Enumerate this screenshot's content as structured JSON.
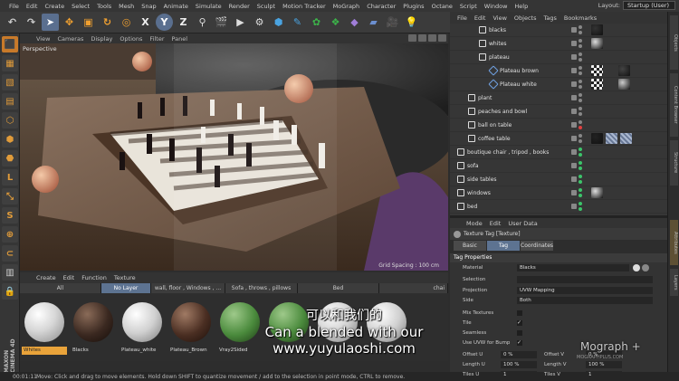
{
  "menubar": {
    "items": [
      "File",
      "Edit",
      "Create",
      "Select",
      "Tools",
      "Mesh",
      "Snap",
      "Animate",
      "Simulate",
      "Render",
      "Sculpt",
      "Motion Tracker",
      "MoGraph",
      "Character",
      "Plugins",
      "Octane",
      "Script",
      "Window",
      "Help"
    ],
    "layout_label": "Layout:",
    "layout_value": "Startup (User)"
  },
  "toolbar": {
    "icons": [
      "arrow-icon",
      "move-icon",
      "scale-icon",
      "rotate-icon",
      "recent-icon",
      "x-axis",
      "y-axis",
      "z-axis",
      "coord-icon",
      "render-region-icon",
      "render-view-icon",
      "render-settings-icon",
      "cube-icon",
      "pen-icon",
      "subdivide-icon",
      "array-icon",
      "deformer-icon",
      "floor-icon",
      "camera-icon",
      "light-icon"
    ],
    "x": "X",
    "y": "Y",
    "z": "Z"
  },
  "viewport": {
    "menu": [
      "View",
      "Cameras",
      "Display",
      "Options",
      "Filter",
      "Panel"
    ],
    "label": "Perspective",
    "grid": "Grid Spacing : 100 cm"
  },
  "materials": {
    "menu": [
      "Create",
      "Edit",
      "Function",
      "Texture"
    ],
    "tabs": [
      "All",
      "No Layer",
      "wall, floor , Windows , ...",
      "Sofa , throws , pillows",
      "Bed",
      "chai"
    ],
    "active_tab": "No Layer",
    "items": [
      "Whites",
      "Blacks",
      "Plateau_white",
      "Plateau_Brown",
      "Vray2Sided",
      ""
    ],
    "active_item": "Whites"
  },
  "subtitle": {
    "cn": "可以和我们的",
    "en1": "Can a blended with our",
    "en2": "www.yuyulaoshi.com"
  },
  "maxon": "MAXON CINEMA 4D",
  "status": {
    "time": "00:01:11",
    "text": "Move: Click and drag to move elements. Hold down SHIFT to quantize movement / add to the selection in point mode, CTRL to remove."
  },
  "objects": {
    "menu": [
      "File",
      "Edit",
      "View",
      "Objects",
      "Tags",
      "Bookmarks"
    ],
    "rows": [
      {
        "name": "blacks",
        "indent": 2
      },
      {
        "name": "whites",
        "indent": 2
      },
      {
        "name": "plateau",
        "indent": 2
      },
      {
        "name": "Plateau brown",
        "indent": 3
      },
      {
        "name": "Plateau white",
        "indent": 3
      },
      {
        "name": "plant",
        "indent": 1
      },
      {
        "name": "peaches and bowl",
        "indent": 1
      },
      {
        "name": "ball on table",
        "indent": 1
      },
      {
        "name": "coffee table",
        "indent": 1
      },
      {
        "name": "boutique chair , tripod , books",
        "indent": 0
      },
      {
        "name": "sofa",
        "indent": 0
      },
      {
        "name": "side tables",
        "indent": 0
      },
      {
        "name": "windows",
        "indent": 0
      },
      {
        "name": "bed",
        "indent": 0
      }
    ]
  },
  "attributes": {
    "menu": [
      "Mode",
      "Edit",
      "User Data"
    ],
    "head": "Texture Tag [Texture]",
    "tabs": [
      "Basic",
      "Tag",
      "Coordinates"
    ],
    "active_tab": "Tag",
    "section": "Tag Properties",
    "material_label": "Material",
    "material_value": "Blacks",
    "selection_label": "Selection",
    "projection_label": "Projection",
    "projection_value": "UVW Mapping",
    "side_label": "Side",
    "side_value": "Both",
    "mix_label": "Mix Textures",
    "tile_label": "Tile",
    "seamless_label": "Seamless",
    "uvw_label": "Use UVW for Bump",
    "offset_u_label": "Offset U",
    "offset_u_value": "0 %",
    "offset_v_label": "Offset V",
    "offset_v_value": "0 %",
    "length_u_label": "Length U",
    "length_u_value": "100 %",
    "length_v_label": "Length V",
    "length_v_value": "100 %",
    "tiles_u_label": "Tiles U",
    "tiles_u_value": "1",
    "tiles_v_label": "Tiles V",
    "tiles_v_value": "1"
  },
  "right_tabs": [
    "Objects",
    "Content Browser",
    "Structure",
    "Attributes",
    "Layers"
  ],
  "watermark": {
    "main": "Mograph +",
    "sub": "MOGRAPHPLUS.COM"
  },
  "colors": {
    "accent": "#5d7391",
    "highlight": "#e9a33a"
  }
}
